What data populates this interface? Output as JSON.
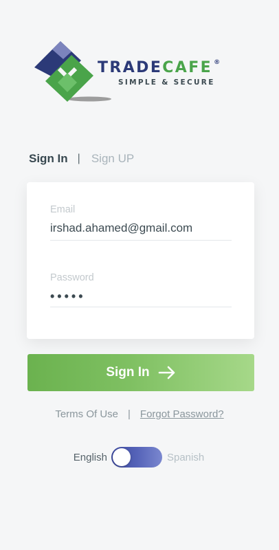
{
  "logo": {
    "name_part1": "TRADE",
    "name_part2": "CAFE",
    "registered_mark": "®",
    "tagline": "SIMPLE & SECURE",
    "colors": {
      "navy": "#2c3a78",
      "green": "#4aa44a"
    }
  },
  "tabs": {
    "active": "Sign In",
    "separator": "|",
    "inactive": "Sign UP"
  },
  "form": {
    "email_label": "Email",
    "email_value": "irshad.ahamed@gmail.com",
    "password_label": "Password",
    "password_value": "•••••"
  },
  "button": {
    "label": "Sign In",
    "icon": "arrow-right-icon",
    "gradient": [
      "#6bb24f",
      "#a6d889"
    ]
  },
  "links": {
    "terms": "Terms Of Use",
    "separator": "|",
    "forgot": "Forgot Password?"
  },
  "language": {
    "left": "English",
    "right": "Spanish",
    "selected": "English",
    "toggle_colors": [
      "#3d4aa0",
      "#7a87cf"
    ]
  }
}
